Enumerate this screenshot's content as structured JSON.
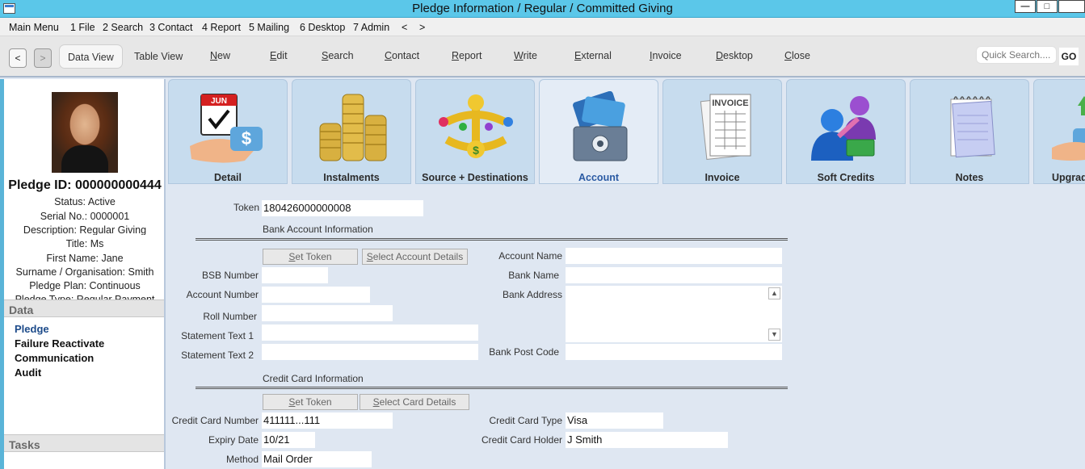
{
  "window": {
    "title": "Pledge Information / Regular / Committed Giving",
    "minimize": "—",
    "maximize": "□"
  },
  "menu": {
    "items": [
      "Main Menu",
      "1 File",
      "2 Search",
      "3 Contact",
      "4 Report",
      "5 Mailing",
      "6 Desktop",
      "7 Admin",
      "<",
      ">"
    ]
  },
  "toolbar": {
    "back": "<",
    "forward": ">",
    "data_view": "Data View",
    "table_view": "Table View",
    "items": [
      {
        "ul": "N",
        "rest": "ew"
      },
      {
        "ul": "E",
        "rest": "dit"
      },
      {
        "ul": "S",
        "rest": "earch"
      },
      {
        "ul": "C",
        "rest": "ontact"
      },
      {
        "ul": "R",
        "rest": "eport"
      },
      {
        "ul": "W",
        "rest": "rite"
      },
      {
        "ul": "E",
        "rest": "xternal"
      },
      {
        "ul": "I",
        "rest": "nvoice"
      },
      {
        "ul": "D",
        "rest": "esktop"
      },
      {
        "ul": "C",
        "rest": "lose"
      }
    ],
    "quick_search_placeholder": "Quick Search....",
    "go": "GO"
  },
  "left": {
    "pledge_id": "Pledge ID: 000000000444",
    "info": [
      "Status: Active",
      "Serial No.: 0000001",
      "Description: Regular Giving",
      "Title: Ms",
      "First Name: Jane",
      "Surname / Organisation: Smith",
      "Pledge Plan: Continuous",
      "Pledge Type: Regular Payment"
    ],
    "data_header": "Data",
    "data_links": [
      "Pledge",
      "Failure Reactivate",
      "Communication",
      "Audit"
    ],
    "tasks_header": "Tasks"
  },
  "tabs": [
    {
      "label": "Detail",
      "icon": "calendar-hand-icon"
    },
    {
      "label": "Instalments",
      "icon": "coins-icon"
    },
    {
      "label": "Source + Destinations",
      "icon": "money-arrows-icon"
    },
    {
      "label": "Account",
      "icon": "credit-card-safe-icon"
    },
    {
      "label": "Invoice",
      "icon": "invoice-icon"
    },
    {
      "label": "Soft Credits",
      "icon": "people-money-icon"
    },
    {
      "label": "Notes",
      "icon": "notepad-icon"
    },
    {
      "label": "Upgrade",
      "icon": "upgrade-icon"
    }
  ],
  "jun": "JUN",
  "invoice_word": "INVOICE",
  "form": {
    "token_label": "Token",
    "token_value": "180426000000008",
    "bank_section": "Bank Account Information",
    "set_token": {
      "ul": "S",
      "rest": "et Token"
    },
    "select_account": {
      "ul": "S",
      "rest": "elect Account Details"
    },
    "bsb_label": "BSB Number",
    "account_number_label": "Account Number",
    "roll_number_label": "Roll Number",
    "statement1_label": "Statement Text 1",
    "statement2_label": "Statement Text 2",
    "account_name_label": "Account Name",
    "bank_name_label": "Bank Name",
    "bank_address_label": "Bank Address",
    "bank_post_code_label": "Bank Post Code",
    "cc_section": "Credit Card Information",
    "select_card": {
      "ul": "S",
      "rest": "elect Card Details"
    },
    "cc_number_label": "Credit Card Number",
    "cc_number_value": "411111...111",
    "expiry_label": "Expiry Date",
    "expiry_value": "10/21",
    "method_label": "Method",
    "method_value": "Mail Order",
    "cc_type_label": "Credit Card Type",
    "cc_type_value": "Visa",
    "cc_holder_label": "Credit Card Holder",
    "cc_holder_value": "J Smith"
  }
}
